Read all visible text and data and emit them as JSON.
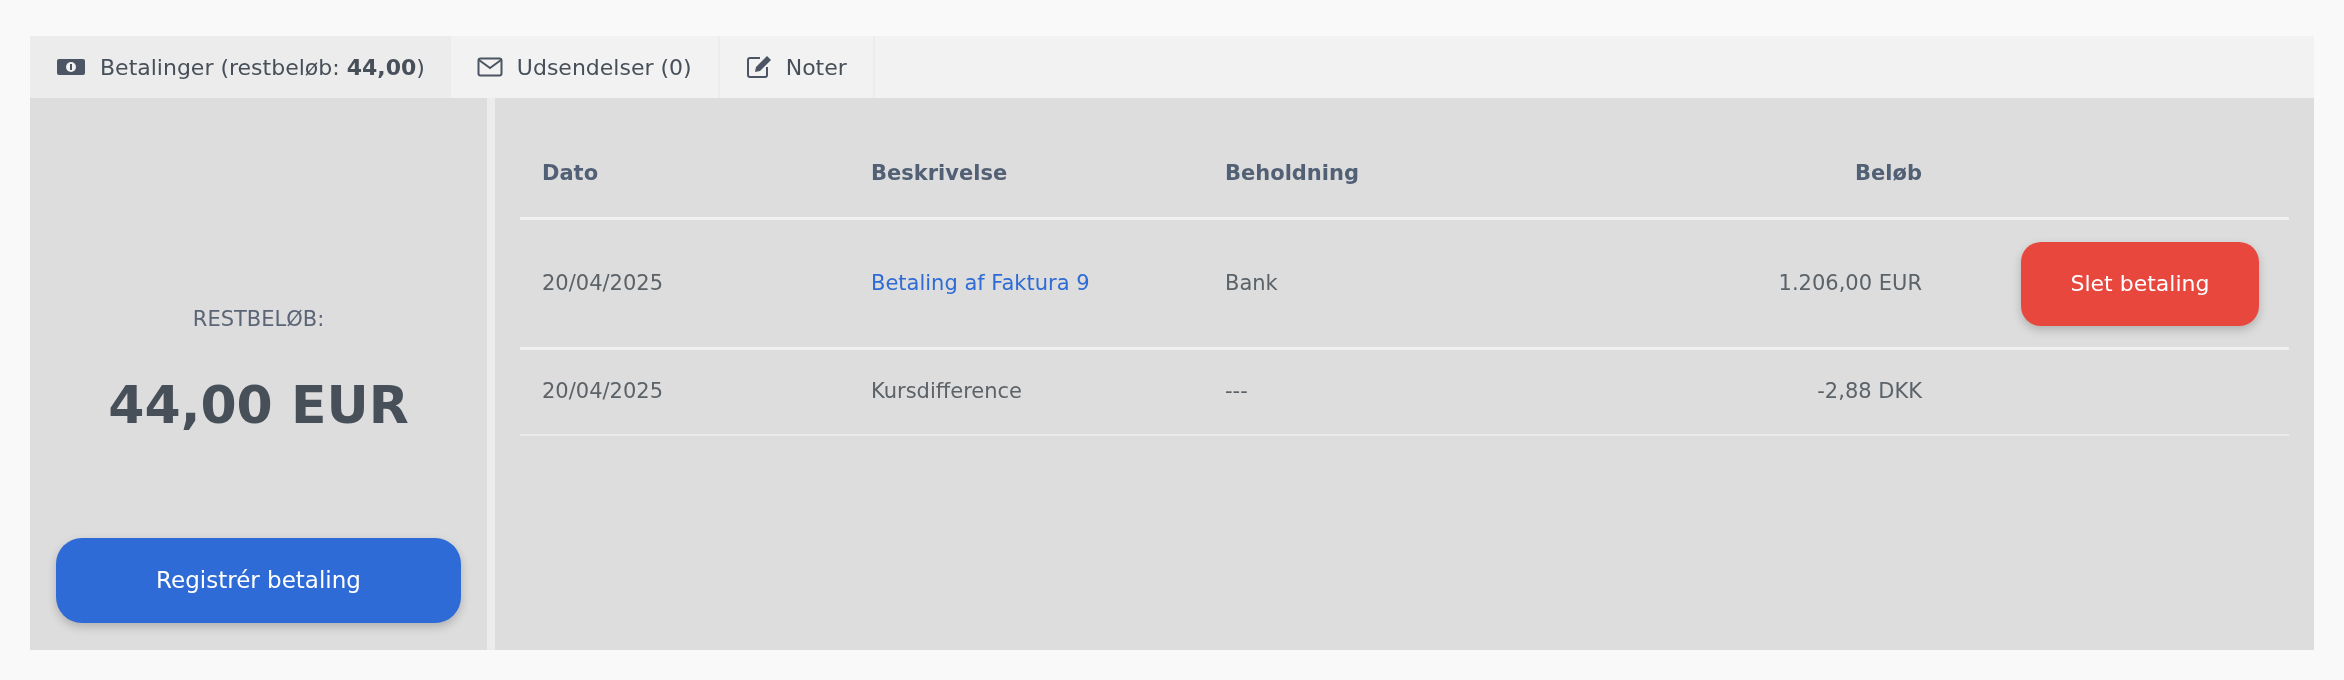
{
  "tabs": [
    {
      "label": "Betalinger (restbeløb: **44,00**)",
      "selected": true
    },
    {
      "label": "Udsendelser (0)",
      "selected": false
    },
    {
      "label": "Noter",
      "selected": false
    }
  ],
  "summary": {
    "label": "RESTBELØB:",
    "amount": "44,00 EUR",
    "button": "Registrér betaling"
  },
  "table": {
    "columns": [
      "Dato",
      "Beskrivelse",
      "Beholdning",
      "Beløb"
    ],
    "rows": [
      {
        "date": "20/04/2025",
        "description": {
          "text": "Betaling af Faktura 9",
          "kind": "link"
        },
        "holding": "Bank",
        "amount": "1.206,00 EUR",
        "action": "Slet betaling"
      },
      {
        "date": "20/04/2025",
        "description": {
          "text": "Kursdifference",
          "kind": "text"
        },
        "holding": "---",
        "amount": "-2,88 DKK"
      }
    ]
  }
}
